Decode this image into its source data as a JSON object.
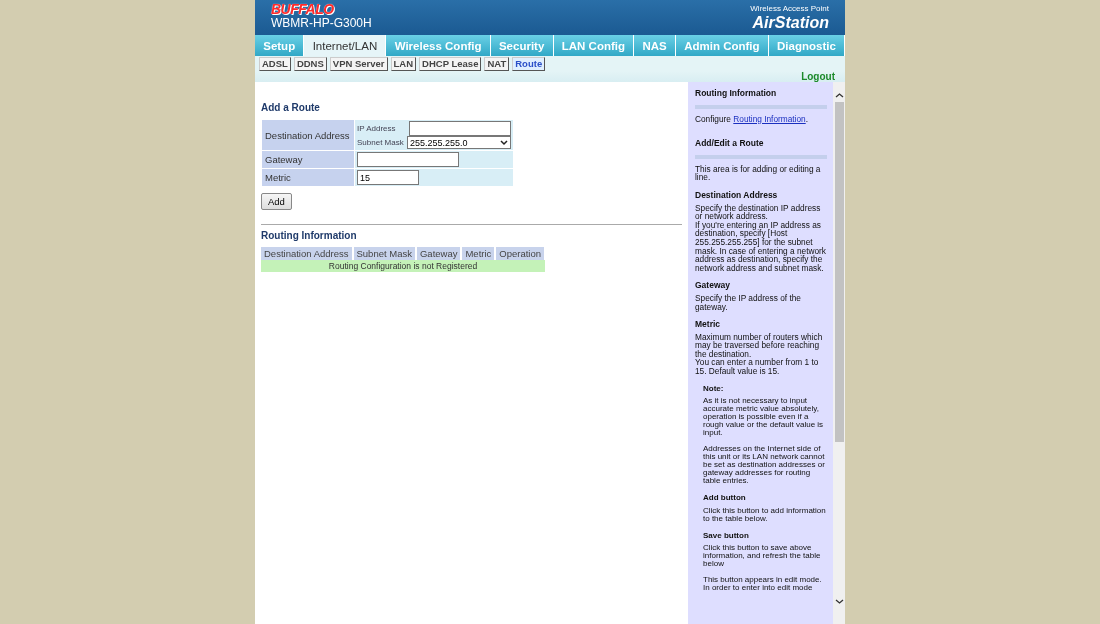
{
  "header": {
    "brand": "BUFFALO",
    "model": "WBMR-HP-G300H",
    "product_caption": "Wireless Access Point",
    "product_name": "AirStation"
  },
  "tabs": [
    {
      "label": "Setup",
      "selected": false
    },
    {
      "label": "Internet/LAN",
      "selected": true
    },
    {
      "label": "Wireless Config",
      "selected": false
    },
    {
      "label": "Security",
      "selected": false
    },
    {
      "label": "LAN Config",
      "selected": false
    },
    {
      "label": "NAS",
      "selected": false
    },
    {
      "label": "Admin Config",
      "selected": false
    },
    {
      "label": "Diagnostic",
      "selected": false
    }
  ],
  "subtabs": [
    {
      "label": "ADSL",
      "selected": false
    },
    {
      "label": "DDNS",
      "selected": false
    },
    {
      "label": "VPN Server",
      "selected": false
    },
    {
      "label": "LAN",
      "selected": false
    },
    {
      "label": "DHCP Lease",
      "selected": false
    },
    {
      "label": "NAT",
      "selected": false
    },
    {
      "label": "Route",
      "selected": true
    }
  ],
  "logout": "Logout",
  "add_route": {
    "title": "Add a Route",
    "destination_label": "Destination Address",
    "ip_label": "IP Address",
    "mask_label": "Subnet Mask",
    "mask_value": "255.255.255.0",
    "gateway_label": "Gateway",
    "metric_label": "Metric",
    "metric_value": "15",
    "add_button": "Add"
  },
  "routing_info": {
    "title": "Routing Information",
    "columns": [
      "Destination Address",
      "Subnet Mask",
      "Gateway",
      "Metric",
      "Operation"
    ],
    "empty_message": "Routing Configuration is not Registered"
  },
  "help": [
    {
      "kind": "section",
      "text": "Routing Information"
    },
    {
      "kind": "linkline",
      "before": "Configure ",
      "link": "Routing Information",
      "after": "."
    },
    {
      "kind": "section",
      "text": "Add/Edit a Route"
    },
    {
      "kind": "para",
      "text": "This area is for adding or editing a line."
    },
    {
      "kind": "heading",
      "text": "Destination Address"
    },
    {
      "kind": "para",
      "text": "Specify the destination IP address or network address."
    },
    {
      "kind": "para",
      "text": "If you're entering an IP address as destination, specify [Host 255.255.255.255] for the subnet mask. In case of entering a network address as destination, specify the network address and subnet mask."
    },
    {
      "kind": "heading",
      "text": "Gateway"
    },
    {
      "kind": "para",
      "text": "Specify the IP address of the gateway."
    },
    {
      "kind": "heading",
      "text": "Metric"
    },
    {
      "kind": "para",
      "text": "Maximum number of routers which may be traversed before reaching the destination."
    },
    {
      "kind": "para",
      "text": "You can enter a number from 1 to 15. Default value is 15."
    },
    {
      "kind": "subheading",
      "text": "Note:"
    },
    {
      "kind": "note",
      "text": "As it is not necessary to input accurate metric value absolutely, operation is possible even if a rough value or the default value is input."
    },
    {
      "kind": "note",
      "text": "Addresses on the Internet side of this unit or its LAN network cannot be set as destination addresses or gateway addresses for routing table entries."
    },
    {
      "kind": "subheading",
      "text": "Add button"
    },
    {
      "kind": "note",
      "text": "Click this button to add information to the table below."
    },
    {
      "kind": "subheading",
      "text": "Save button"
    },
    {
      "kind": "note",
      "text": "Click this button to save above information, and refresh the table below"
    },
    {
      "kind": "note",
      "text": "This button appears in edit mode. In order to enter into edit mode"
    }
  ]
}
